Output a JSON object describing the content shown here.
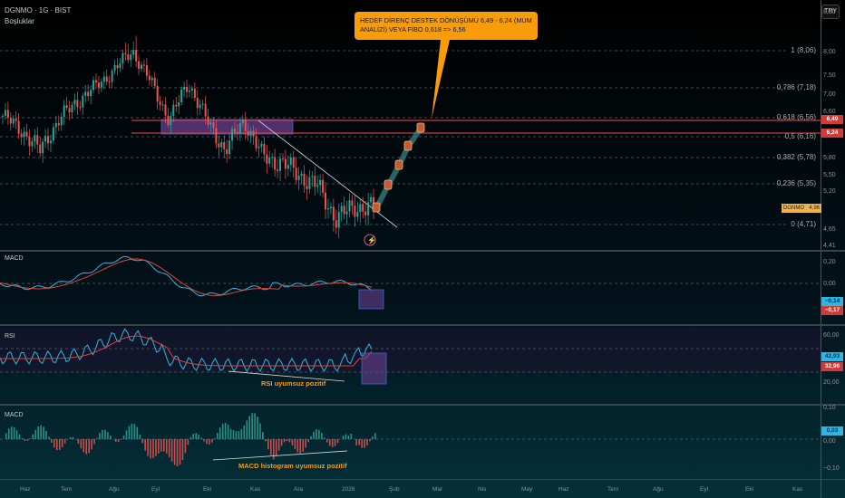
{
  "header": {
    "symbol": "DGNMO · 1G · BIST",
    "subtitle": "Boşluklar",
    "currency": "TRY"
  },
  "annotation": "HEDEF DİRENÇ DESTEK DÖNÜŞÜMÜ 6,49 - 6,24 (MUM ANALİZİ) VEYA FİBO 0,618 => 6,56",
  "price_axis": [
    "8,50",
    "8,00",
    "7,50",
    "7,00",
    "6,60",
    "5,80",
    "5,50",
    "5,20",
    "4,65",
    "4,41"
  ],
  "price_badges": {
    "upper": "6,49",
    "lower": "6,24",
    "last_symbol": "DGNMO",
    "last": "4,96"
  },
  "fib_levels": [
    "1 (8,06)",
    "0,786 (7,18)",
    "0,618 (6,56)",
    "0,5 (6,16)",
    "0,382 (5,78)",
    "0,236 (5,35)",
    "0 (4,71)"
  ],
  "macd": {
    "title": "MACD",
    "axis": [
      "0,20",
      "0,00"
    ],
    "macd_value": "−0,14",
    "signal_value": "−0,17"
  },
  "rsi": {
    "title": "RSI",
    "axis": [
      "60,00",
      "20,00"
    ],
    "rsi_value": "42,93",
    "ma_value": "32,96",
    "note": "RSI uyumsuz pozitif"
  },
  "hist": {
    "title": "MACD",
    "axis": [
      "0,10",
      "0,00",
      "−0,10"
    ],
    "value": "0,03",
    "note": "MACD histogram uyumsuz pozitif"
  },
  "time_axis": [
    "Haz",
    "Tem",
    "Ağu",
    "Eyl",
    "Eki",
    "Kas",
    "Ara",
    "2026",
    "Şub",
    "Mar",
    "Nis",
    "May",
    "Haz",
    "Tem",
    "Ağu",
    "Eyl",
    "Eki",
    "Kas"
  ],
  "colors": {
    "up": "#26a69a",
    "down": "#ef5350",
    "macd": "#2bb7e0",
    "signal": "#e0413a",
    "annotation": "#f89c0b",
    "box": "#6a3f8f"
  },
  "chart_data": {
    "type": "candlestick",
    "key_closes": [
      6.6,
      6.3,
      5.9,
      6.5,
      6.9,
      7.2,
      7.6,
      8.06,
      7.3,
      6.5,
      7.3,
      6.5,
      5.9,
      6.5,
      5.8,
      5.7,
      5.5,
      5.3,
      4.8,
      5.0,
      4.96
    ],
    "ylim": [
      4.41,
      8.5
    ]
  }
}
